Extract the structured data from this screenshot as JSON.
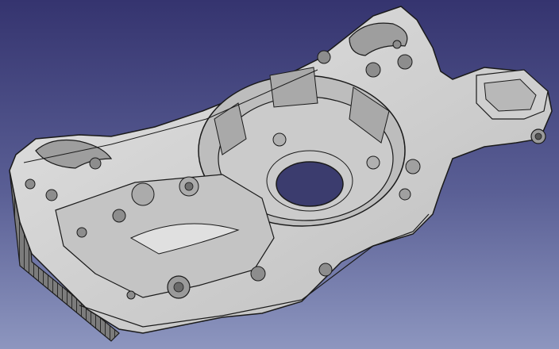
{
  "viewport": {
    "background_top_color": "#35346f",
    "background_bottom_color": "#8d96bf"
  },
  "model": {
    "body_color": "#d3d3d3",
    "shadow_color": "#8a8a8a",
    "edge_color": "#1a1a1a"
  }
}
